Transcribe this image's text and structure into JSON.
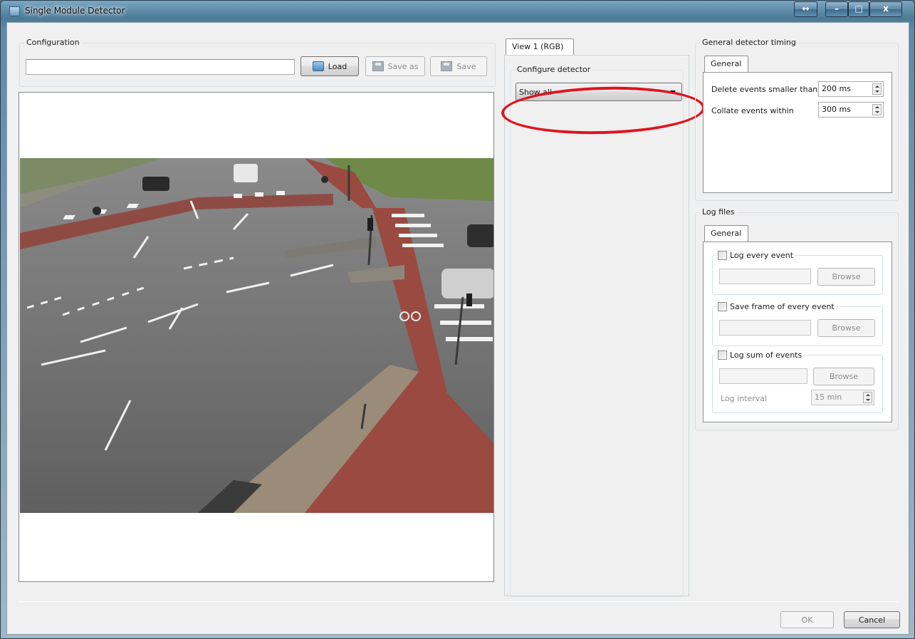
{
  "window": {
    "title": "Single Module Detector",
    "icon": "app-icon",
    "controls": {
      "arrows": "↔",
      "minimize": "–",
      "maximize": "□",
      "close": "x"
    }
  },
  "configuration": {
    "title": "Configuration",
    "path_value": "",
    "load_label": "Load",
    "save_as_label": "Save as",
    "save_label": "Save"
  },
  "view_tab": {
    "label": "View 1 (RGB)",
    "configure_label": "Configure detector",
    "combo_value": "Show all"
  },
  "timing": {
    "title": "General detector timing",
    "tab_label": "General",
    "delete_label": "Delete events smaller than",
    "delete_value": "200 ms",
    "collate_label": "Collate events within",
    "collate_value": "300 ms"
  },
  "log_files": {
    "title": "Log files",
    "tab_label": "General",
    "log_every_event_label": "Log every event",
    "log_every_event_checked": false,
    "save_frame_label": "Save frame of every event",
    "save_frame_checked": false,
    "log_sum_label": "Log sum of events",
    "log_sum_checked": false,
    "browse_label": "Browse",
    "log_interval_label": "Log interval",
    "log_interval_value": "15 min"
  },
  "footer": {
    "ok_label": "OK",
    "cancel_label": "Cancel"
  },
  "colors": {
    "annotation": "#e0141e",
    "window_frame": "#5e8aa6",
    "client_bg": "#f0f0f0"
  }
}
